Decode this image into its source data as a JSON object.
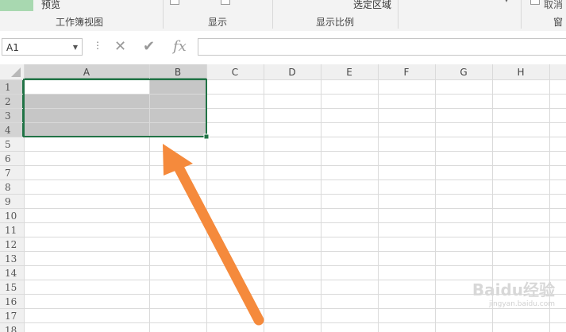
{
  "ribbon": {
    "preview_label": "预览",
    "workbook_views_label": "工作簿视图",
    "display_label": "显示",
    "zoom_label": "显示比例",
    "selection_label": "选定区域",
    "window_label": "窗",
    "cancel_label": "取消",
    "accent_color": "#217346"
  },
  "formula_bar": {
    "name_box_value": "A1",
    "cancel_glyph": "✕",
    "enter_glyph": "✔",
    "fx_glyph": "fx",
    "formula_value": ""
  },
  "sheet": {
    "columns": [
      "A",
      "B",
      "C",
      "D",
      "E",
      "F",
      "G",
      "H"
    ],
    "rows": [
      "1",
      "2",
      "3",
      "4",
      "5",
      "6",
      "7",
      "8",
      "9",
      "10",
      "11",
      "12",
      "13",
      "14",
      "15",
      "16",
      "17",
      "18"
    ],
    "selection": "A1:B4",
    "selection_fill": "#c6c6c6",
    "arrow_color": "#f58a3c"
  },
  "watermark": {
    "text": "Baidu经验",
    "sub": "jingyan.baidu.com"
  }
}
